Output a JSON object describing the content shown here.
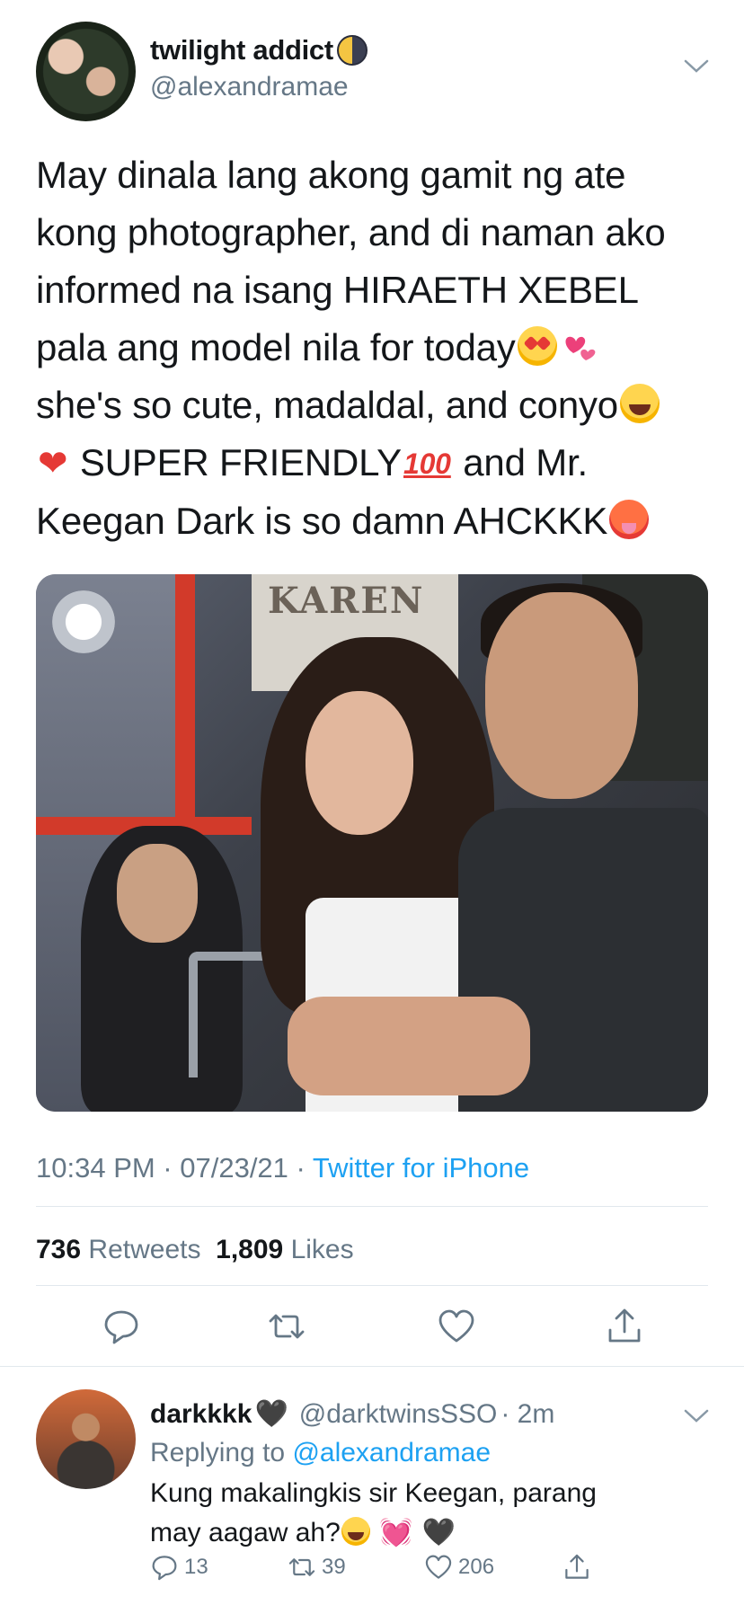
{
  "tweet": {
    "display_name": "twilight addict",
    "handle": "@alexandramae",
    "text_lines": {
      "l1": "May dinala lang akong gamit ng ate",
      "l2": "kong photographer, and di naman ako",
      "l3": "informed na isang HIRAETH XEBEL",
      "l4": "pala ang model nila for today",
      "l5": "she's so cute, madaldal, and conyo",
      "l6a": "SUPER FRIENDLY",
      "l6b": "and Mr.",
      "l7": "Keegan Dark is so damn AHCKKK"
    },
    "photo_sign_text": "KAREN",
    "timestamp": "10:34 PM · 07/23/21 · ",
    "source": "Twitter for iPhone",
    "retweets_count": "736",
    "retweets_label": "Retweets",
    "likes_count": "1,809",
    "likes_label": "Likes"
  },
  "reply": {
    "display_name": "darkkkk",
    "handle": "@darktwinsSSO",
    "time": "· 2m",
    "replying_prefix": "Replying to",
    "replying_to": "@alexandramae",
    "text_line1": "Kung makalingkis sir Keegan, parang",
    "text_line2": "may aagaw ah?",
    "reply_count": "13",
    "retweet_count": "39",
    "like_count": "206"
  },
  "colors": {
    "accent": "#1da1f2",
    "secondary_text": "#657786",
    "primary_text": "#14171a",
    "divider": "#e1e8ed"
  }
}
